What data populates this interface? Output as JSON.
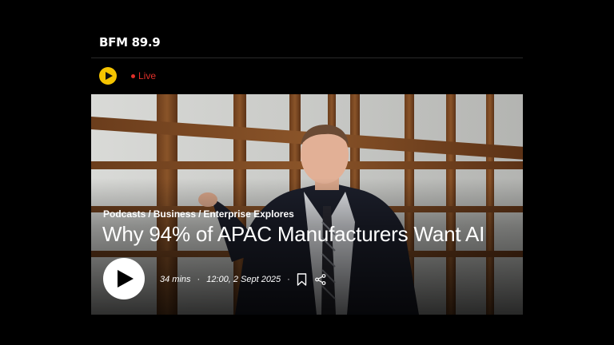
{
  "brand": {
    "logo_text": "BFM 89.9"
  },
  "live_bar": {
    "live_label": "Live",
    "play_icon": "play-icon",
    "accent": "#f5c400",
    "live_color": "#e0302a"
  },
  "hero": {
    "breadcrumb": [
      "Podcasts",
      "Business",
      "Enterprise Explores"
    ],
    "breadcrumb_separator": "/",
    "title": "Why 94% of APAC Manufacturers Want AI",
    "duration": "34 mins",
    "datetime": "12:00, 2 Sept 2025",
    "meta_separator": "·",
    "icons": [
      "play-icon",
      "bookmark-icon",
      "share-icon"
    ]
  }
}
